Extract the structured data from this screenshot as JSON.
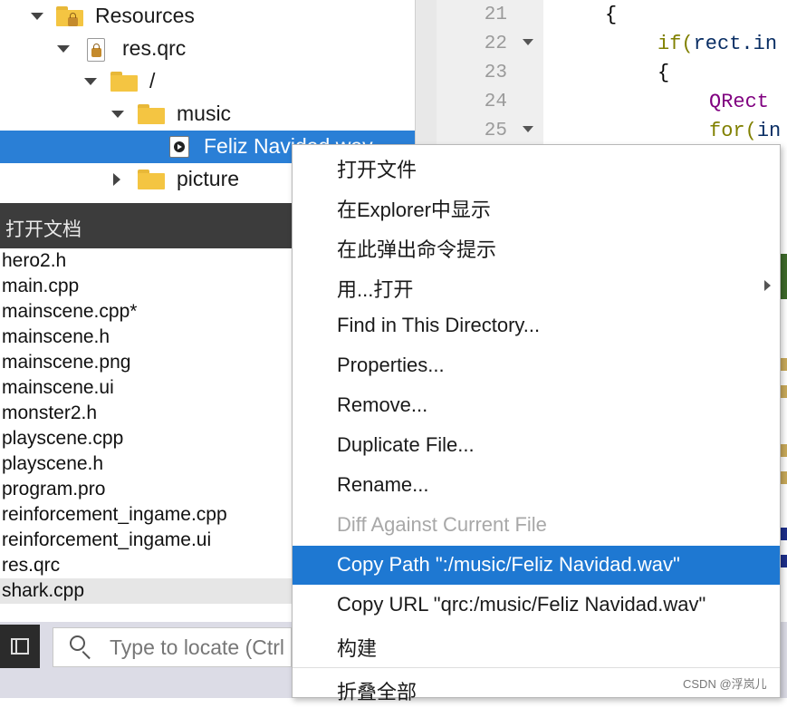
{
  "project_tree": {
    "items": [
      {
        "label": "Resources",
        "kind": "resources-folder"
      },
      {
        "label": "res.qrc",
        "kind": "qrc-file"
      },
      {
        "label": "/",
        "kind": "folder"
      },
      {
        "label": "music",
        "kind": "folder"
      },
      {
        "label": "Feliz Navidad.wav",
        "kind": "wav-file",
        "selected": true
      },
      {
        "label": "picture",
        "kind": "folder"
      }
    ]
  },
  "open_docs": {
    "title": "打开文档",
    "files": [
      "hero2.h",
      "main.cpp",
      "mainscene.cpp*",
      "mainscene.h",
      "mainscene.png",
      "mainscene.ui",
      "monster2.h",
      "playscene.cpp",
      "playscene.h",
      "program.pro",
      "reinforcement_ingame.cpp",
      "reinforcement_ingame.ui",
      "res.qrc",
      "shark.cpp"
    ],
    "highlighted": "shark.cpp"
  },
  "locator": {
    "placeholder": "Type to locate (Ctrl"
  },
  "editor": {
    "line_numbers": [
      "21",
      "22",
      "23",
      "24",
      "25"
    ],
    "lines": [
      {
        "t1": "{"
      },
      {
        "t1": "if(",
        "t2": "rect.in"
      },
      {
        "t1": "{"
      },
      {
        "t1": "QRect"
      },
      {
        "t1": "for(",
        "t2": "in"
      }
    ]
  },
  "context_menu": {
    "items": [
      {
        "label": "打开文件"
      },
      {
        "label": "在Explorer中显示"
      },
      {
        "label": "在此弹出命令提示"
      },
      {
        "label": "用...打开",
        "submenu": true
      },
      {
        "label": "Find in This Directory..."
      },
      {
        "label": "Properties..."
      },
      {
        "label": "Remove..."
      },
      {
        "label": "Duplicate File..."
      },
      {
        "label": "Rename..."
      },
      {
        "label": "Diff Against Current File",
        "disabled": true
      },
      {
        "label": "Copy Path \":/music/Feliz Navidad.wav\"",
        "active": true
      },
      {
        "label": "Copy URL \"qrc:/music/Feliz Navidad.wav\""
      },
      {
        "label": "构建"
      },
      {
        "label": "折叠全部"
      }
    ]
  },
  "watermark": "CSDN @浮岚儿",
  "colors": {
    "selection": "#2a7fd6",
    "menu_active": "#1e78d2",
    "header_dark": "#3c3c3c"
  }
}
